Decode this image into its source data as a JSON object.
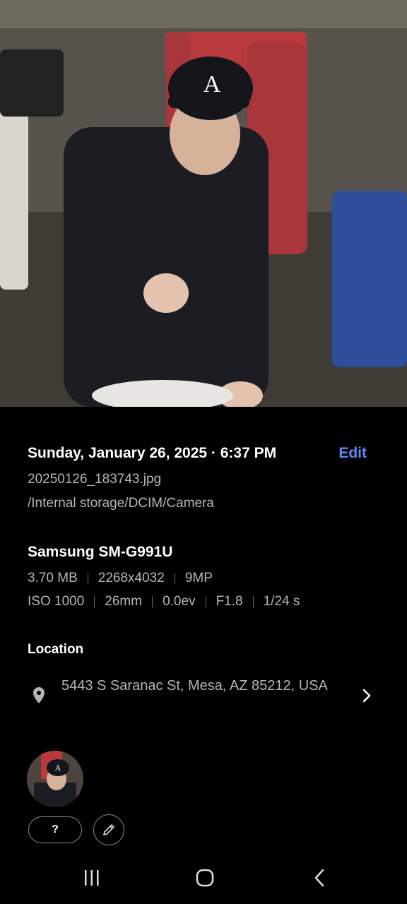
{
  "photo": {
    "description_icon": "photo-thumbnail"
  },
  "details": {
    "date": "Sunday, January 26, 2025 · 6:37 PM",
    "edit_label": "Edit",
    "filename": "20250126_183743.jpg",
    "path": "/Internal storage/DCIM/Camera",
    "device": "Samsung SM-G991U",
    "specs_row1": [
      "3.70 MB",
      "2268x4032",
      "9MP"
    ],
    "specs_row2": [
      "ISO 1000",
      "26mm",
      "0.0ev",
      "F1.8",
      "1/24 s"
    ]
  },
  "location": {
    "title": "Location",
    "address": "5443 S Saranac St, Mesa, AZ 85212, USA"
  },
  "people": {
    "unknown_tag_label": "?"
  },
  "colors": {
    "accent": "#5b8cf7",
    "muted_text": "#b5b5b5",
    "background": "#000000"
  }
}
